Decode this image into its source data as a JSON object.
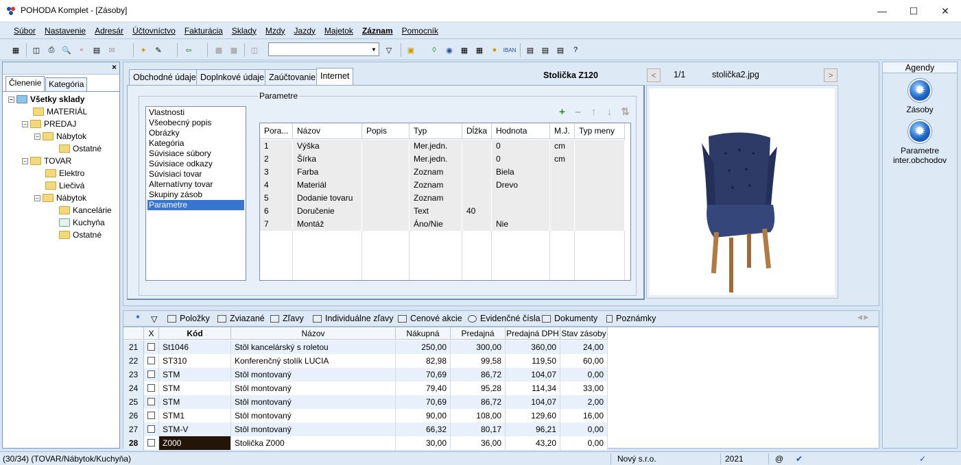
{
  "window": {
    "title": "POHODA Komplet - [Zásoby]"
  },
  "menu": [
    "Súbor",
    "Nastavenie",
    "Adresár",
    "Účtovníctvo",
    "Fakturácia",
    "Sklady",
    "Mzdy",
    "Jazdy",
    "Majetok",
    "Záznam",
    "Pomocník"
  ],
  "left_panel": {
    "tabs": [
      "Členenie",
      "Kategória"
    ],
    "tree": [
      {
        "label": "Všetky sklady"
      },
      {
        "label": "MATERIÁL"
      },
      {
        "label": "PREDAJ"
      },
      {
        "label": "Nábytok"
      },
      {
        "label": "Ostatné"
      },
      {
        "label": "TOVAR"
      },
      {
        "label": "Elektro"
      },
      {
        "label": "Liečivá"
      },
      {
        "label": "Nábytok"
      },
      {
        "label": "Kancelárie"
      },
      {
        "label": "Kuchyňa"
      },
      {
        "label": "Ostatné"
      }
    ]
  },
  "center": {
    "tabs": [
      "Obchodné údaje",
      "Doplnkové údaje",
      "Zaúčtovanie",
      "Internet"
    ],
    "product_title": "Stolička Z120",
    "param_legend": "Parametre",
    "sections": [
      "Vlastnosti",
      "Všeobecný popis",
      "Obrázky",
      "Kategória",
      "Súvisiace súbory",
      "Súvisiace odkazy",
      "Súvisiaci tovar",
      "Alternatívny tovar",
      "Skupiny zásob",
      "Parametre"
    ],
    "param_table": {
      "headers": [
        "Pora...",
        "Názov",
        "Popis",
        "Typ",
        "Dĺžka",
        "Hodnota",
        "M.J.",
        "Typ meny"
      ],
      "rows": [
        [
          "1",
          "Výška",
          "",
          "Mer.jedn.",
          "",
          "0",
          "cm",
          ""
        ],
        [
          "2",
          "Šírka",
          "",
          "Mer.jedn.",
          "",
          "0",
          "cm",
          ""
        ],
        [
          "3",
          "Farba",
          "",
          "Zoznam",
          "",
          "Biela",
          "",
          ""
        ],
        [
          "4",
          "Materiál",
          "",
          "Zoznam",
          "",
          "Drevo",
          "",
          ""
        ],
        [
          "5",
          "Dodanie tovaru",
          "",
          "Zoznam",
          "",
          "",
          "",
          ""
        ],
        [
          "6",
          "Doručenie",
          "",
          "Text",
          "40",
          "",
          "",
          ""
        ],
        [
          "7",
          "Montáž",
          "",
          "Áno/Nie",
          "",
          "Nie",
          "",
          ""
        ]
      ]
    },
    "image": {
      "counter": "1/1",
      "filename": "stolička2.jpg",
      "prev": "<",
      "next": ">"
    }
  },
  "agendy": {
    "title": "Agendy",
    "items": [
      {
        "label": "Zásoby"
      },
      {
        "label": "Parametre inter.obchodov"
      }
    ]
  },
  "bottom_tabs": [
    "*",
    "Položky",
    "Zviazané",
    "Zľavy",
    "Individuálne zľavy",
    "Cenové akcie",
    "Evidenčné čísla",
    "Dokumenty",
    "Poznámky"
  ],
  "bottom_grid": {
    "headers": [
      "",
      "X",
      "Kód",
      "Názov",
      "Nákupná",
      "Predajná",
      "Predajná DPH",
      "Stav zásoby"
    ],
    "rows": [
      [
        "21",
        "St1046",
        "Stôl kancelárský s roletou",
        "250,00",
        "300,00",
        "360,00",
        "24,00"
      ],
      [
        "22",
        "ST310",
        "Konferenčný stolík LUCIA",
        "82,98",
        "99,58",
        "119,50",
        "60,00"
      ],
      [
        "23",
        "STM",
        "Stôl montovaný",
        "70,69",
        "86,72",
        "104,07",
        "0,00"
      ],
      [
        "24",
        "STM",
        "Stôl montovaný",
        "79,40",
        "95,28",
        "114,34",
        "33,00"
      ],
      [
        "25",
        "STM",
        "Stôl montovaný",
        "70,69",
        "86,72",
        "104,07",
        "2,00"
      ],
      [
        "26",
        "STM1",
        "Stôl montovaný",
        "90,00",
        "108,00",
        "129,60",
        "16,00"
      ],
      [
        "27",
        "STM-V",
        "Stôl montovaný",
        "66,32",
        "80,17",
        "96,21",
        "0,00"
      ],
      [
        "28",
        "Z000",
        "Stolička Z000",
        "30,00",
        "36,00",
        "43,20",
        "0,00"
      ]
    ]
  },
  "status": {
    "path": "(30/34) (TOVAR/Nábytok/Kuchyňa)",
    "company": "Nový s.r.o.",
    "year": "2021",
    "at": "@"
  }
}
